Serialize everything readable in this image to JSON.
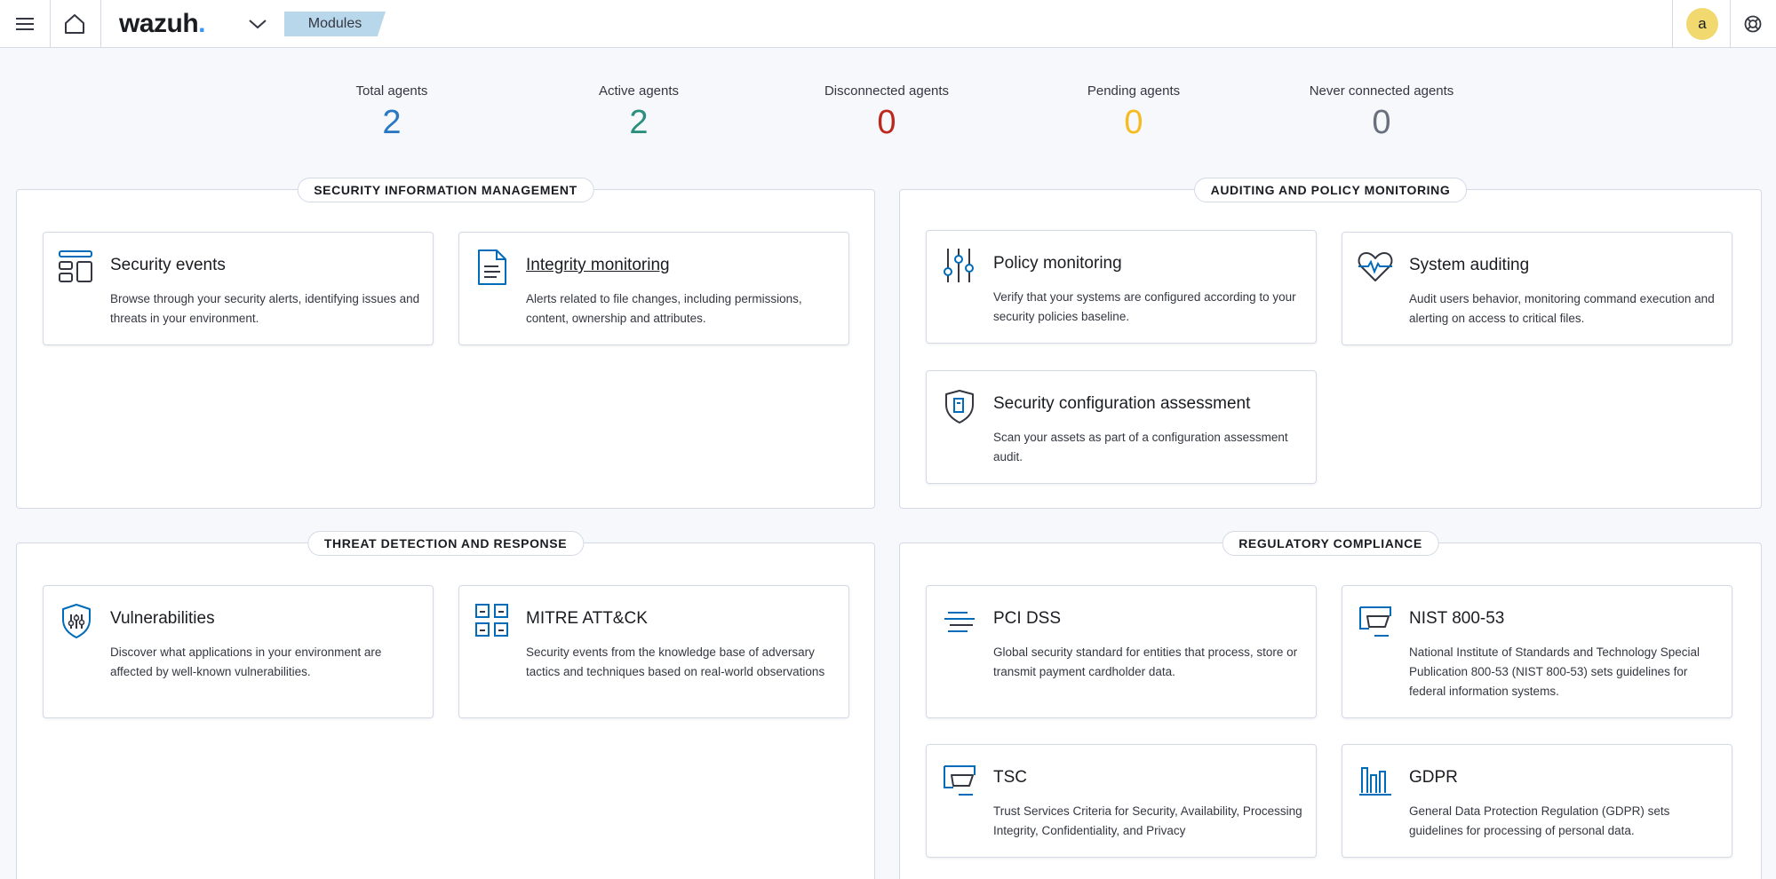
{
  "header": {
    "logo_text": "wazuh",
    "logo_dot": ".",
    "breadcrumb": "Modules",
    "avatar_initial": "a",
    "icons": [
      "menu-icon",
      "home-icon",
      "chevron-down-icon",
      "help-icon"
    ]
  },
  "stats": [
    {
      "label": "Total agents",
      "value": "2",
      "color": "#2a78c2"
    },
    {
      "label": "Active agents",
      "value": "2",
      "color": "#2b8f7d"
    },
    {
      "label": "Disconnected agents",
      "value": "0",
      "color": "#bd271e"
    },
    {
      "label": "Pending agents",
      "value": "0",
      "color": "#f5bb21"
    },
    {
      "label": "Never connected agents",
      "value": "0",
      "color": "#69707d"
    }
  ],
  "panels": {
    "security_info": {
      "title": "SECURITY INFORMATION MANAGEMENT",
      "cards": [
        {
          "title": "Security events",
          "desc": "Browse through your security alerts, identifying issues and threats in your environment.",
          "icon": "dashboard-layout-icon"
        },
        {
          "title": "Integrity monitoring",
          "desc": "Alerts related to file changes, including permissions, content, ownership and attributes.",
          "icon": "document-icon"
        }
      ]
    },
    "auditing": {
      "title": "AUDITING AND POLICY MONITORING",
      "cards": [
        {
          "title": "Policy monitoring",
          "desc": "Verify that your systems are configured according to your security policies baseline.",
          "icon": "sliders-icon"
        },
        {
          "title": "System auditing",
          "desc": "Audit users behavior, monitoring command execution and alerting on access to critical files.",
          "icon": "heartbeat-icon"
        },
        {
          "title": "Security configuration assessment",
          "desc": "Scan your assets as part of a configuration assessment audit.",
          "icon": "shield-document-icon"
        }
      ]
    },
    "threat": {
      "title": "THREAT DETECTION AND RESPONSE",
      "cards": [
        {
          "title": "Vulnerabilities",
          "desc": "Discover what applications in your environment are affected by well-known vulnerabilities.",
          "icon": "shield-bug-icon"
        },
        {
          "title": "MITRE ATT&CK",
          "desc": "Security events from the knowledge base of adversary tactics and techniques based on real-world observations",
          "icon": "grid-icon"
        }
      ]
    },
    "compliance": {
      "title": "REGULATORY COMPLIANCE",
      "cards": [
        {
          "title": "PCI DSS",
          "desc": "Global security standard for entities that process, store or transmit payment cardholder data.",
          "icon": "lines-icon"
        },
        {
          "title": "NIST 800-53",
          "desc": "National Institute of Standards and Technology Special Publication 800-53 (NIST 800-53) sets guidelines for federal information systems.",
          "icon": "monitor-icon"
        },
        {
          "title": "TSC",
          "desc": "Trust Services Criteria for Security, Availability, Processing Integrity, Confidentiality, and Privacy",
          "icon": "monitor-icon"
        },
        {
          "title": "GDPR",
          "desc": "General Data Protection Regulation (GDPR) sets guidelines for processing of personal data.",
          "icon": "columns-icon"
        }
      ]
    }
  }
}
